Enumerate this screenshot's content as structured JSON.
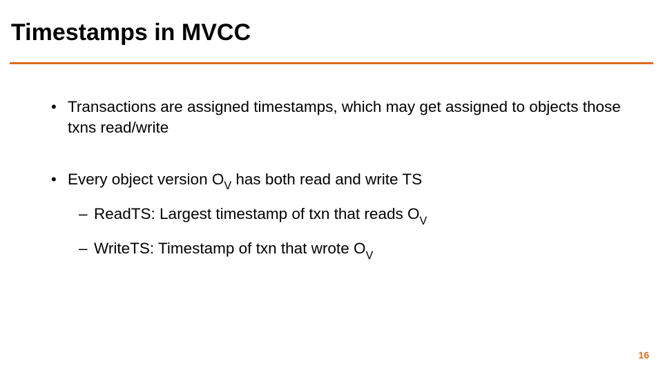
{
  "slide": {
    "title": "Timestamps in MVCC",
    "page_number": "16"
  },
  "bullets": {
    "b1": "Transactions are assigned timestamps, which may get assigned to objects those txns read/write",
    "b2_pre": "Every object version O",
    "b2_sub": "V",
    "b2_post": " has both read and write TS",
    "b2a_pre": "ReadTS:  Largest timestamp of txn that reads O",
    "b2a_sub": "V",
    "b2b_pre": "WriteTS:  Timestamp of txn that wrote O",
    "b2b_sub": "V"
  }
}
